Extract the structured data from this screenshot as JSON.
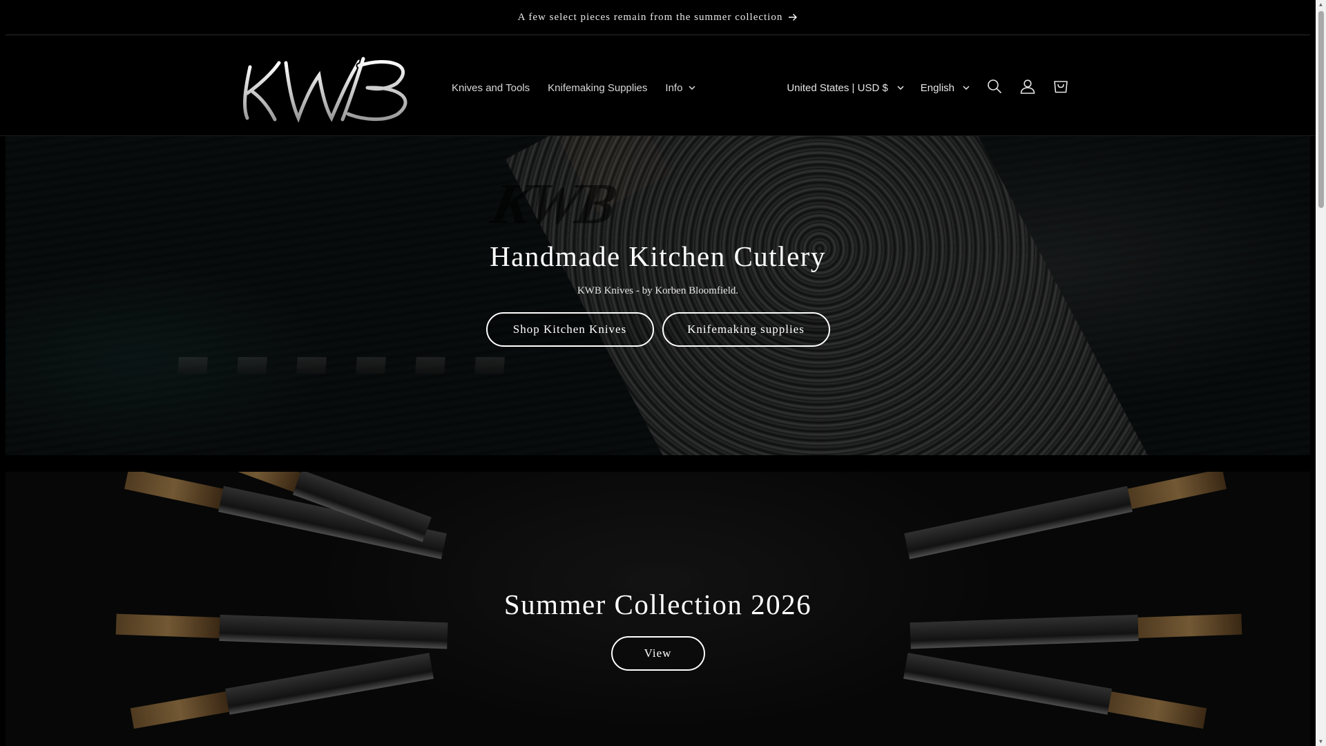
{
  "announcement": {
    "text": "A few select pieces remain from the summer collection"
  },
  "header": {
    "logo_text": "KWB",
    "nav": [
      {
        "label": "Knives and Tools"
      },
      {
        "label": "Knifemaking Supplies"
      },
      {
        "label": "Info"
      }
    ],
    "country_selector": "United States | USD $",
    "language_selector": "English",
    "icons": [
      "search-icon",
      "account-icon",
      "cart-icon"
    ]
  },
  "hero": {
    "title": "Handmade Kitchen Cutlery",
    "subtitle": "KWB Knives - by Korben Bloomfield.",
    "watermark": "KWB",
    "buttons": [
      {
        "label": "Shop Kitchen Knives"
      },
      {
        "label": "Knifemaking supplies"
      }
    ]
  },
  "collection": {
    "title": "Summer Collection 2026",
    "button": "View"
  },
  "colors": {
    "background": "#000000",
    "text": "#ffffff",
    "nav_text": "#d8d8d8"
  }
}
